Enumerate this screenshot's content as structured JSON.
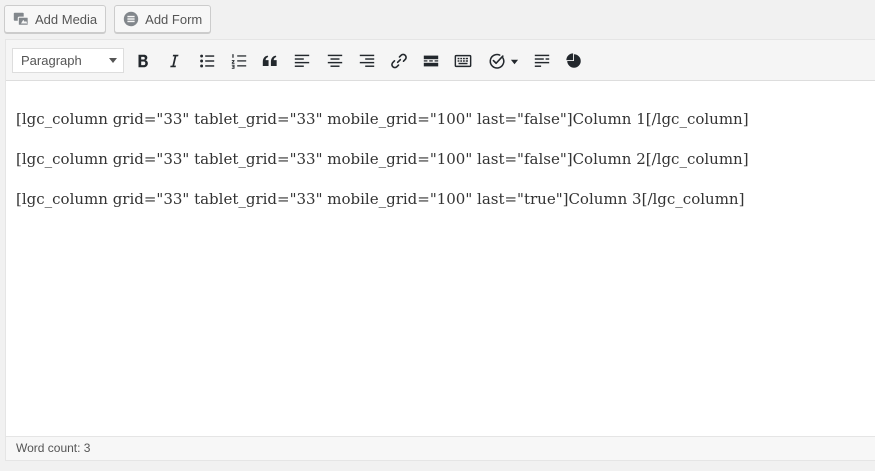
{
  "media_buttons": {
    "add_media": {
      "label": "Add Media",
      "icon": "media-icon"
    },
    "add_form": {
      "label": "Add Form",
      "icon": "form-icon"
    }
  },
  "toolbar": {
    "format_select": {
      "selected": "Paragraph"
    },
    "buttons": [
      "bold-icon",
      "italic-icon",
      "bulleted-list-icon",
      "numbered-list-icon",
      "blockquote-icon",
      "align-left-icon",
      "align-center-icon",
      "align-right-icon",
      "link-icon",
      "read-more-icon",
      "keyboard-icon",
      "shortcode-icon",
      "toolbar-toggle-icon",
      "chart-icon"
    ]
  },
  "content": {
    "paragraphs": [
      "[lgc_column grid=\"33\" tablet_grid=\"33\" mobile_grid=\"100\" last=\"false\"]Column 1[/lgc_column]",
      "[lgc_column grid=\"33\" tablet_grid=\"33\" mobile_grid=\"100\" last=\"false\"]Column 2[/lgc_column]",
      "[lgc_column grid=\"33\" tablet_grid=\"33\" mobile_grid=\"100\" last=\"true\"]Column 3[/lgc_column]"
    ]
  },
  "status": {
    "word_count": "Word count: 3"
  },
  "colors": {
    "page_background": "#f1f1f1",
    "toolbar_background": "#f5f5f5",
    "icon_color": "#23282d"
  }
}
